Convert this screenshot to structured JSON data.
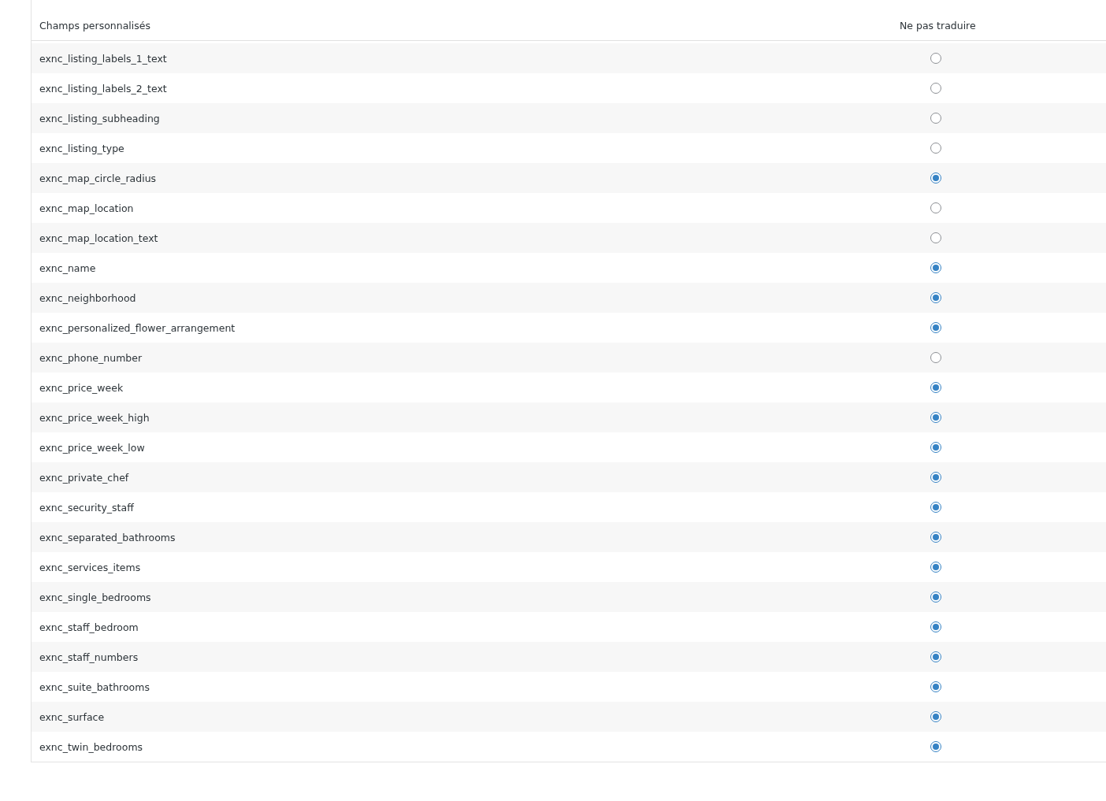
{
  "table": {
    "columns": [
      "Champs personnalisés",
      "Ne pas traduire"
    ],
    "rows": [
      {
        "field": "exnc_listing_labels_1_text",
        "checked": false
      },
      {
        "field": "exnc_listing_labels_2_text",
        "checked": false
      },
      {
        "field": "exnc_listing_subheading",
        "checked": false
      },
      {
        "field": "exnc_listing_type",
        "checked": false
      },
      {
        "field": "exnc_map_circle_radius",
        "checked": true
      },
      {
        "field": "exnc_map_location",
        "checked": false
      },
      {
        "field": "exnc_map_location_text",
        "checked": false
      },
      {
        "field": "exnc_name",
        "checked": true
      },
      {
        "field": "exnc_neighborhood",
        "checked": true
      },
      {
        "field": "exnc_personalized_flower_arrangement",
        "checked": true
      },
      {
        "field": "exnc_phone_number",
        "checked": false
      },
      {
        "field": "exnc_price_week",
        "checked": true
      },
      {
        "field": "exnc_price_week_high",
        "checked": true
      },
      {
        "field": "exnc_price_week_low",
        "checked": true
      },
      {
        "field": "exnc_private_chef",
        "checked": true
      },
      {
        "field": "exnc_security_staff",
        "checked": true
      },
      {
        "field": "exnc_separated_bathrooms",
        "checked": true
      },
      {
        "field": "exnc_services_items",
        "checked": true
      },
      {
        "field": "exnc_single_bedrooms",
        "checked": true
      },
      {
        "field": "exnc_staff_bedroom",
        "checked": true
      },
      {
        "field": "exnc_staff_numbers",
        "checked": true
      },
      {
        "field": "exnc_suite_bathrooms",
        "checked": true
      },
      {
        "field": "exnc_surface",
        "checked": true
      },
      {
        "field": "exnc_twin_bedrooms",
        "checked": true
      }
    ]
  }
}
